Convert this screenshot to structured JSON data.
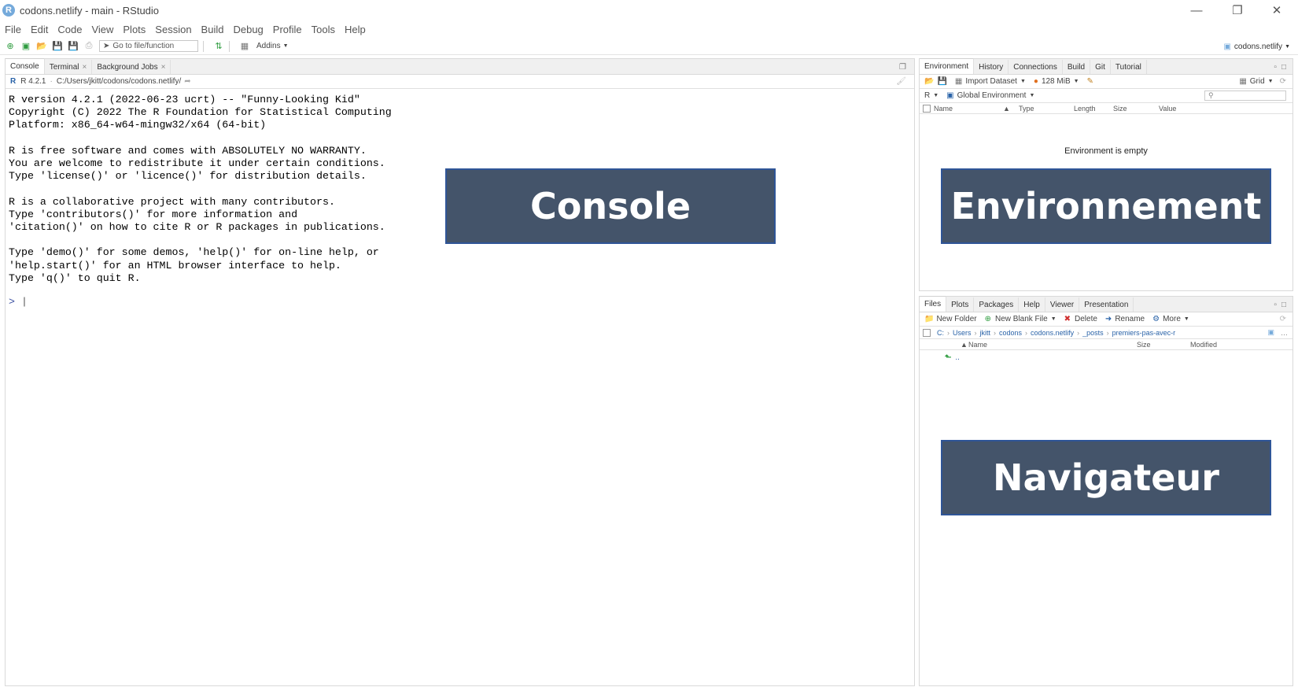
{
  "window": {
    "title": "codons.netlify - main - RStudio",
    "app_icon": "R"
  },
  "menu": [
    "File",
    "Edit",
    "Code",
    "View",
    "Plots",
    "Session",
    "Build",
    "Debug",
    "Profile",
    "Tools",
    "Help"
  ],
  "toolbar": {
    "goto_placeholder": "Go to file/function",
    "addins_label": "Addins",
    "project_label": "codons.netlify"
  },
  "console_pane": {
    "tabs": [
      {
        "label": "Console"
      },
      {
        "label": "Terminal"
      },
      {
        "label": "Background Jobs"
      }
    ],
    "r_version": "R 4.2.1",
    "path": "C:/Users/jkitt/codons/codons.netlify/",
    "startup_text": "R version 4.2.1 (2022-06-23 ucrt) -- \"Funny-Looking Kid\"\nCopyright (C) 2022 The R Foundation for Statistical Computing\nPlatform: x86_64-w64-mingw32/x64 (64-bit)\n\nR is free software and comes with ABSOLUTELY NO WARRANTY.\nYou are welcome to redistribute it under certain conditions.\nType 'license()' or 'licence()' for distribution details.\n\nR is a collaborative project with many contributors.\nType 'contributors()' for more information and\n'citation()' on how to cite R or R packages in publications.\n\nType 'demo()' for some demos, 'help()' for on-line help, or\n'help.start()' for an HTML browser interface to help.\nType 'q()' to quit R.",
    "prompt": ">"
  },
  "env_pane": {
    "tabs": [
      "Environment",
      "History",
      "Connections",
      "Build",
      "Git",
      "Tutorial"
    ],
    "import_label": "Import Dataset",
    "memory_label": "128 MiB",
    "grid_label": "Grid",
    "lang_label": "R",
    "scope_label": "Global Environment",
    "columns": [
      "Name",
      "Type",
      "Length",
      "Size",
      "Value"
    ],
    "empty_text": "Environment is empty"
  },
  "files_pane": {
    "tabs": [
      "Files",
      "Plots",
      "Packages",
      "Help",
      "Viewer",
      "Presentation"
    ],
    "new_folder": "New Folder",
    "new_blank_file": "New Blank File",
    "delete": "Delete",
    "rename": "Rename",
    "more": "More",
    "breadcrumbs": [
      "C:",
      "Users",
      "jkitt",
      "codons",
      "codons.netlify",
      "_posts",
      "premiers-pas-avec-r"
    ],
    "columns": [
      "Name",
      "Size",
      "Modified"
    ],
    "parent_row": ".."
  },
  "overlays": {
    "console": "Console",
    "environment": "Environnement",
    "navigator": "Navigateur"
  },
  "colors": {
    "overlay_bg": "#44546a",
    "overlay_border": "#2f5597",
    "r_blue": "#75aadb"
  }
}
